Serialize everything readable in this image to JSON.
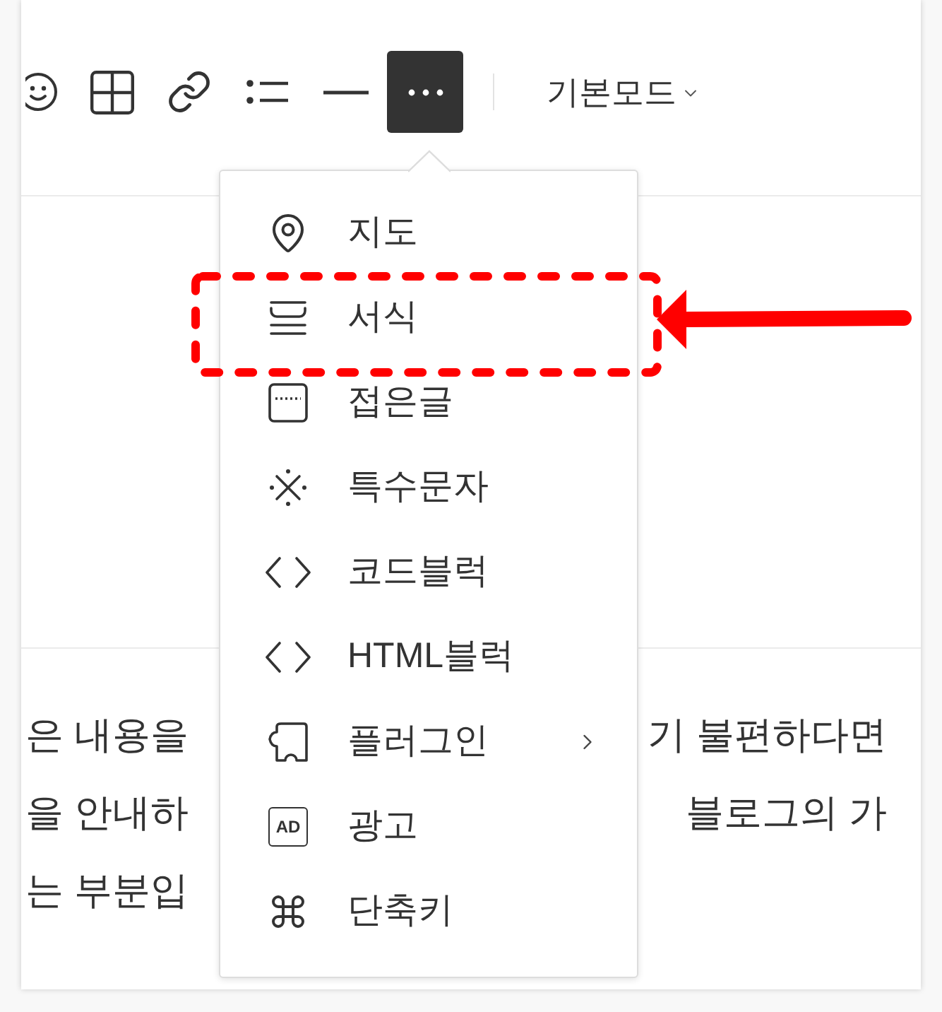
{
  "toolbar": {
    "buttons": [
      {
        "selected": false
      },
      {
        "selected": false
      },
      {
        "selected": false
      },
      {
        "selected": false
      },
      {
        "selected": false
      },
      {
        "selected": true
      }
    ],
    "mode_selector": {
      "label": "기본모드"
    }
  },
  "menu": {
    "items": [
      {
        "label": "지도",
        "has_submenu": false,
        "highlighted": false
      },
      {
        "label": "서식",
        "has_submenu": false,
        "highlighted": true
      },
      {
        "label": "접은글",
        "has_submenu": false,
        "highlighted": false
      },
      {
        "label": "특수문자",
        "has_submenu": false,
        "highlighted": false
      },
      {
        "label": "코드블럭",
        "has_submenu": false,
        "highlighted": false
      },
      {
        "label": "HTML블럭",
        "has_submenu": false,
        "highlighted": false
      },
      {
        "label": "플러그인",
        "has_submenu": true,
        "highlighted": false
      },
      {
        "label": "광고",
        "has_submenu": false,
        "highlighted": false,
        "icon_label": "AD"
      },
      {
        "label": "단축키",
        "has_submenu": false,
        "highlighted": false
      }
    ]
  },
  "paragraph_lines": [
    {
      "left_part": "은 내용을",
      "right_part": "기 불편하다면"
    },
    {
      "left_part": "을 안내하",
      "right_part": "블로그의 가"
    },
    {
      "left_part": "는 부분입"
    }
  ]
}
